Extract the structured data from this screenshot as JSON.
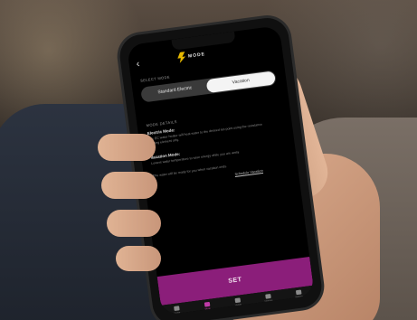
{
  "header": {
    "back": "‹",
    "brand": "MODE"
  },
  "labels": {
    "select_mode": "SELECT MODE",
    "mode_details": "MODE DETAILS"
  },
  "modes": [
    {
      "label": "Standard Electric",
      "selected": false
    },
    {
      "label": "Vacation",
      "selected": true
    }
  ],
  "details": {
    "electric_title": "Electric Mode:",
    "electric_text": "The EC water heater will heat water to the desired set point using the resistance heating element only.",
    "vacation_title": "Vacation Mode:",
    "vacation_text": "Lowers water temperature to save energy while you are away.",
    "vacation_text2": "The water will be ready for you when vacation ends.",
    "link": "Schedule Vacation"
  },
  "set_button": "SET",
  "tabs": [
    {
      "label": "Home",
      "icon": "home-icon",
      "active": false
    },
    {
      "label": "Mode",
      "icon": "mode-icon",
      "active": true
    },
    {
      "label": "Usage",
      "icon": "usage-icon",
      "active": false
    },
    {
      "label": "Devices",
      "icon": "devices-icon",
      "active": false
    },
    {
      "label": "Settings",
      "icon": "settings-icon",
      "active": false
    }
  ],
  "system_nav": {
    "recent": "⦀",
    "home": "○",
    "back": "‹"
  },
  "colors": {
    "accent": "#8b1e7a",
    "brand": "#e6b800"
  }
}
